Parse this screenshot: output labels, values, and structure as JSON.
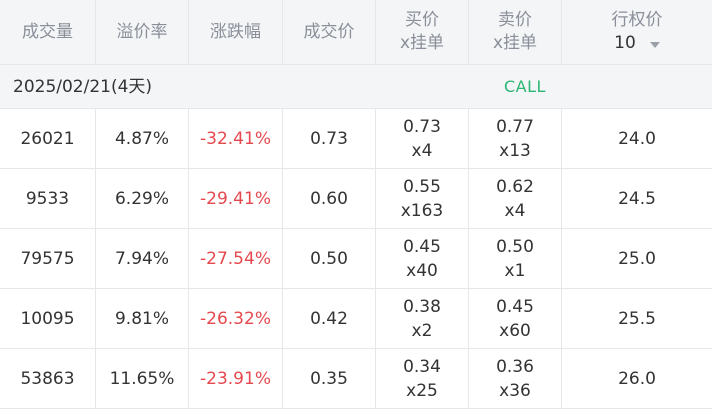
{
  "header": {
    "volume": "成交量",
    "premium": "溢价率",
    "change": "涨跌幅",
    "last": "成交价",
    "bid": [
      "买价",
      "x挂单"
    ],
    "ask": [
      "卖价",
      "x挂单"
    ],
    "strike_label": "行权价",
    "strike_count": "10"
  },
  "group": {
    "expiry": "2025/02/21(4天)",
    "side": "CALL"
  },
  "rows": [
    {
      "volume": "26021",
      "premium": "4.87%",
      "change": "-32.41%",
      "last": "0.73",
      "bid": "0.73",
      "bid_size": "x4",
      "ask": "0.77",
      "ask_size": "x13",
      "strike": "24.0"
    },
    {
      "volume": "9533",
      "premium": "6.29%",
      "change": "-29.41%",
      "last": "0.60",
      "bid": "0.55",
      "bid_size": "x163",
      "ask": "0.62",
      "ask_size": "x4",
      "strike": "24.5"
    },
    {
      "volume": "79575",
      "premium": "7.94%",
      "change": "-27.54%",
      "last": "0.50",
      "bid": "0.45",
      "bid_size": "x40",
      "ask": "0.50",
      "ask_size": "x1",
      "strike": "25.0"
    },
    {
      "volume": "10095",
      "premium": "9.81%",
      "change": "-26.32%",
      "last": "0.42",
      "bid": "0.38",
      "bid_size": "x2",
      "ask": "0.45",
      "ask_size": "x60",
      "strike": "25.5"
    },
    {
      "volume": "53863",
      "premium": "11.65%",
      "change": "-23.91%",
      "last": "0.35",
      "bid": "0.34",
      "bid_size": "x25",
      "ask": "0.36",
      "ask_size": "x36",
      "strike": "26.0"
    }
  ],
  "colors": {
    "negative": "#e5484d",
    "call": "#2bb673",
    "header_text": "#8a8f99",
    "header_bg": "#f4f5f7"
  }
}
